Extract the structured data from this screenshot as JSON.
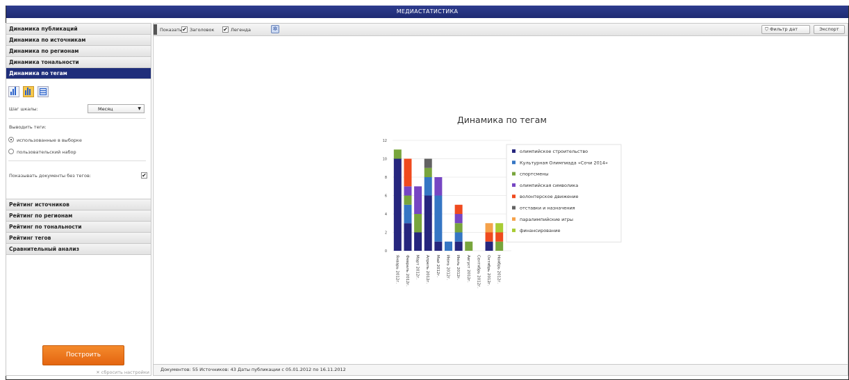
{
  "app": {
    "title": "МЕДИАСТАТИСТИКА"
  },
  "sidebar": {
    "top_sections": [
      "Динамика публикаций",
      "Динамика по источникам",
      "Динамика по регионам",
      "Динамика тональности",
      "Динамика по тегам"
    ],
    "bottom_sections": [
      "Рейтинг источников",
      "Рейтинг по регионам",
      "Рейтинг по тональности",
      "Рейтинг тегов",
      "Сравнительный анализ"
    ],
    "scale_label": "Шаг шкалы:",
    "scale_value": "Месяц",
    "output_tags_label": "Выводить теги:",
    "radio_used": "использованные в выборке",
    "radio_custom": "пользовательский набор",
    "show_untagged_label": "Показывать документы без тегов:",
    "build_button": "Построить",
    "reset_link": "✕ сбросить настройки"
  },
  "toolbar": {
    "show_label": "Показать:",
    "header_label": "Заголовок",
    "legend_label": "Легенда",
    "filter_button": "Фильтр дат",
    "export_button": "Экспорт"
  },
  "status": "Документов: 55  Источников: 43  Даты публикации с 05.01.2012 по 16.11.2012",
  "chart_data": {
    "type": "bar",
    "stacked": true,
    "title": "Динамика по тегам",
    "categories": [
      "Январь 2012г.",
      "Февраль 2012г.",
      "Март 2012г.",
      "Апрель 2012г.",
      "Май 2012г.",
      "Июнь 2012г.",
      "Июль 2012г.",
      "Август 2012г.",
      "Сентябрь 2012г.",
      "Октябрь 2012г.",
      "Ноябрь 2012г."
    ],
    "ylim": [
      0,
      12
    ],
    "yticks": [
      "0",
      "2",
      "4",
      "6",
      "8",
      "10",
      "12"
    ],
    "legend_position": "right",
    "series": [
      {
        "name": "олимпийское строительство",
        "color": "#26267e",
        "values": [
          10,
          3,
          2,
          6,
          1,
          0,
          1,
          0,
          0,
          1,
          0
        ]
      },
      {
        "name": "Культурная Олимпиада «Сочи 2014»",
        "color": "#3576c4",
        "values": [
          0,
          2,
          0,
          2,
          5,
          1,
          1,
          0,
          0,
          0,
          0
        ]
      },
      {
        "name": "спортсмены",
        "color": "#78a53c",
        "values": [
          1,
          1,
          2,
          1,
          0,
          0,
          1,
          1,
          0,
          0,
          1
        ]
      },
      {
        "name": "олимпийская символика",
        "color": "#7646c3",
        "values": [
          0,
          1,
          3,
          0,
          2,
          0,
          1,
          0,
          0,
          0,
          0
        ]
      },
      {
        "name": "волонтерское движение",
        "color": "#ef4a1e",
        "values": [
          0,
          3,
          0,
          0,
          0,
          0,
          1,
          0,
          0,
          1,
          1
        ]
      },
      {
        "name": "отставки и назначения",
        "color": "#626262",
        "values": [
          0,
          0,
          0,
          1,
          0,
          0,
          0,
          0,
          0,
          0,
          0
        ]
      },
      {
        "name": "паралимпийские игры",
        "color": "#f5a24a",
        "values": [
          0,
          0,
          0,
          0,
          0,
          0,
          0,
          0,
          0,
          1,
          0
        ]
      },
      {
        "name": "финансирование",
        "color": "#a8cc34",
        "values": [
          0,
          0,
          0,
          0,
          0,
          0,
          0,
          0,
          0,
          0,
          1
        ]
      }
    ]
  }
}
